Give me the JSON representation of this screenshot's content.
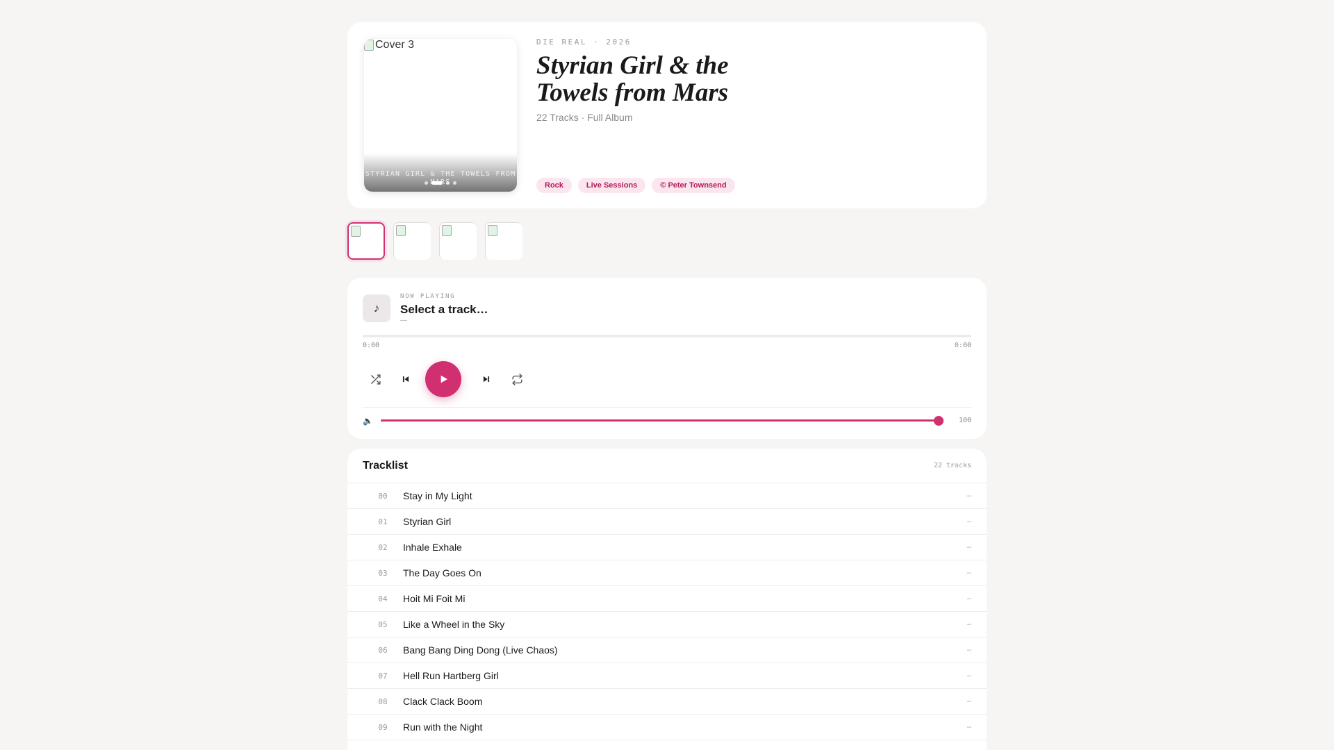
{
  "album": {
    "label": "DIE REAL · 2026",
    "title": "Styrian Girl & the Towels from Mars",
    "subtitle": "22 Tracks · Full Album",
    "cover_alt": "Cover 3",
    "cover_caption": "STYRIAN GIRL & THE TOWELS FROM MARS",
    "tags": [
      "Rock",
      "Live Sessions",
      "© Peter Townsend"
    ]
  },
  "player": {
    "now_playing_label": "NOW PLAYING",
    "track_title": "Select a track…",
    "track_artist": "—",
    "note_icon": "♪",
    "time_current": "0:00",
    "time_total": "0:00",
    "progress": 0,
    "volume": "100",
    "volume_icon": "🔈"
  },
  "tracklist": {
    "title": "Tracklist",
    "count": "22 tracks",
    "tracks": [
      {
        "num": "00",
        "name": "Stay in My Light",
        "dur": "–"
      },
      {
        "num": "01",
        "name": "Styrian Girl",
        "dur": "–"
      },
      {
        "num": "02",
        "name": "Inhale Exhale",
        "dur": "–"
      },
      {
        "num": "03",
        "name": "The Day Goes On",
        "dur": "–"
      },
      {
        "num": "04",
        "name": "Hoit Mi Foit Mi",
        "dur": "–"
      },
      {
        "num": "05",
        "name": "Like a Wheel in the Sky",
        "dur": "–"
      },
      {
        "num": "06",
        "name": "Bang Bang Ding Dong (Live Chaos)",
        "dur": "–"
      },
      {
        "num": "07",
        "name": "Hell Run Hartberg Girl",
        "dur": "–"
      },
      {
        "num": "08",
        "name": "Clack Clack Boom",
        "dur": "–"
      },
      {
        "num": "09",
        "name": "Run with the Night",
        "dur": "–"
      }
    ]
  },
  "colors": {
    "accent": "#d0306f",
    "tag_bg": "#fbe5ee",
    "page_bg": "#f6f5f3"
  }
}
